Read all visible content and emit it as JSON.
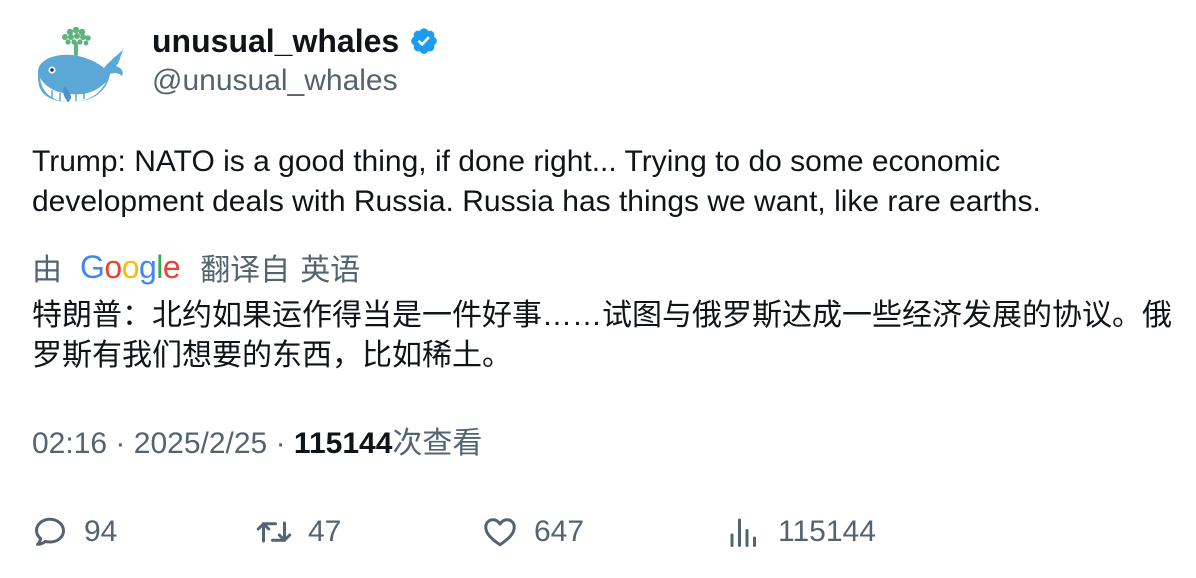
{
  "user": {
    "display_name": "unusual_whales",
    "handle": "@unusual_whales",
    "verified": true,
    "avatar_icon": "whale-icon"
  },
  "tweet": {
    "text": "Trump: NATO is a good thing, if done right... Trying to do some economic development deals with Russia. Russia has things we want, like rare earths."
  },
  "translation": {
    "by_label": "由",
    "provider_letters": [
      "G",
      "o",
      "o",
      "g",
      "l",
      "e"
    ],
    "from_label": "翻译自",
    "language": "英语",
    "text": "特朗普：北约如果运作得当是一件好事……试图与俄罗斯达成一些经济发展的协议。俄罗斯有我们想要的东西，比如稀土。"
  },
  "meta": {
    "time": "02:16",
    "separator": "·",
    "date": "2025/2/25",
    "views_count": "115144",
    "views_label": "次查看"
  },
  "actions": {
    "replies": "94",
    "retweets": "47",
    "likes": "647",
    "views": "115144"
  },
  "colors": {
    "verified": "#1d9bf0",
    "secondary_text": "#536471",
    "primary_text": "#0f1419",
    "google_blue": "#4285F4",
    "google_red": "#EA4335",
    "google_yellow": "#FBBC05",
    "google_green": "#34A853"
  }
}
